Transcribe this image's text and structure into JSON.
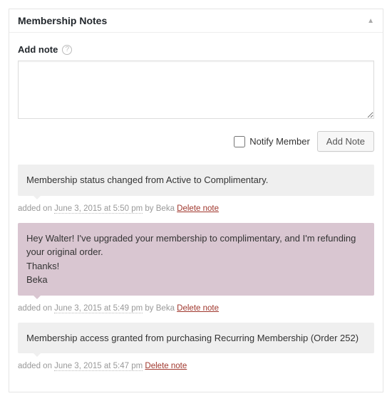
{
  "panel": {
    "title": "Membership Notes",
    "add_label": "Add note",
    "notify_label": "Notify Member",
    "add_button": "Add Note"
  },
  "notes": [
    {
      "type": "system",
      "content": "Membership status changed from Active to Complimentary.",
      "meta_prefix": "added on ",
      "date": "June 3, 2015 at 5:50 pm",
      "by": " by Beka ",
      "delete": "Delete note"
    },
    {
      "type": "customer",
      "content": "Hey Walter! I've upgraded your membership to complimentary, and I'm refunding your original order.\nThanks!\nBeka",
      "meta_prefix": "added on ",
      "date": "June 3, 2015 at 5:49 pm",
      "by": " by Beka ",
      "delete": "Delete note"
    },
    {
      "type": "system",
      "content": "Membership access granted from purchasing Recurring Membership (Order 252)",
      "meta_prefix": "added on ",
      "date": "June 3, 2015 at 5:47 pm",
      "by": " ",
      "delete": "Delete note"
    }
  ]
}
